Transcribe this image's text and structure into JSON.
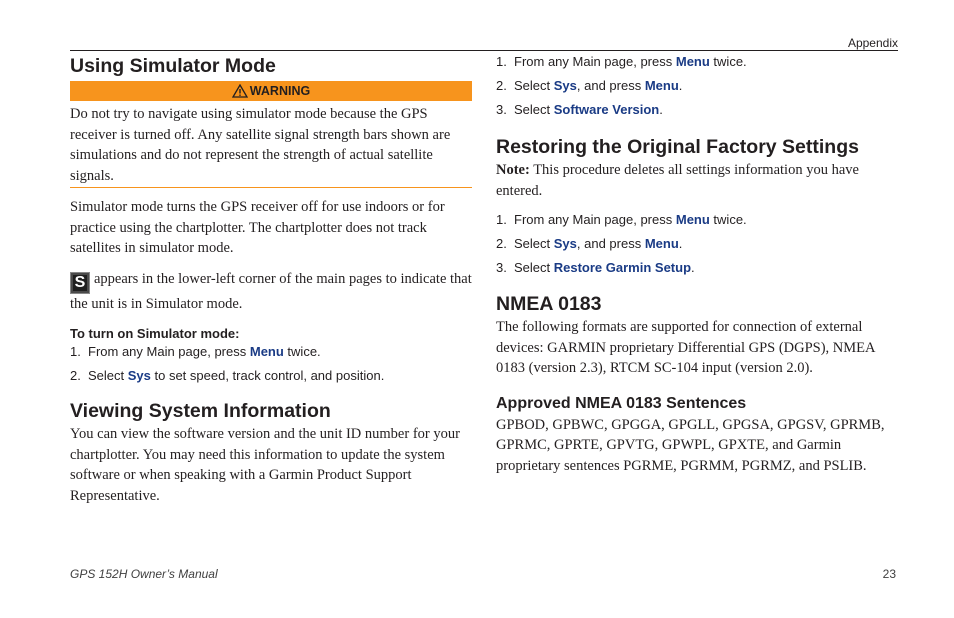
{
  "header": {
    "section": "Appendix"
  },
  "left": {
    "sim_heading": "Using Simulator Mode",
    "warning_label": "WARNING",
    "warning_text": "Do not try to navigate using simulator mode because the GPS receiver is turned off. Any satellite signal strength bars shown are simulations and do not represent the strength of actual satellite signals.",
    "sim_para1": "Simulator mode turns the GPS receiver off for use indoors or for practice using the chartplotter. The chartplotter does not track satellites in simulator mode.",
    "sim_icon_letter": "S",
    "sim_para2": "appears in the lower-left corner of the main pages to indicate that the unit is in Simulator mode.",
    "proc_heading": "To turn on Simulator mode:",
    "steps": [
      {
        "num": "1.",
        "pre": "From any Main page, press ",
        "kw": "Menu",
        "post": " twice."
      },
      {
        "num": "2.",
        "pre": "Select ",
        "kw": "Sys",
        "post": " to set speed, track control, and position."
      }
    ],
    "sysinfo_heading": "Viewing System Information",
    "sysinfo_text": "You can view the software version and the unit ID number for your chartplotter. You may need this information to update the system software or when speaking with a Garmin Product Support Representative."
  },
  "right": {
    "steps_top": [
      {
        "num": "1.",
        "pre": "From any Main page, press ",
        "kw": "Menu",
        "post": " twice."
      },
      {
        "num": "2.",
        "pre": "Select ",
        "kw": "Sys",
        "mid": ", and press ",
        "kw2": "Menu",
        "post": "."
      },
      {
        "num": "3.",
        "pre": "Select ",
        "kw": "Software Version",
        "post": "."
      }
    ],
    "restore_heading": "Restoring the Original Factory Settings",
    "note_label": "Note:",
    "note_text": " This procedure deletes all settings information you have entered.",
    "steps_restore": [
      {
        "num": "1.",
        "pre": "From any Main page, press ",
        "kw": "Menu",
        "post": " twice."
      },
      {
        "num": "2.",
        "pre": "Select ",
        "kw": "Sys",
        "mid": ", and press ",
        "kw2": "Menu",
        "post": "."
      },
      {
        "num": "3.",
        "pre": "Select ",
        "kw": "Restore Garmin Setup",
        "post": "."
      }
    ],
    "nmea_heading": "NMEA 0183",
    "nmea_text": "The following formats are supported for connection of external devices: GARMIN proprietary Differential GPS (DGPS), NMEA 0183 (version 2.3), RTCM SC-104 input (version 2.0).",
    "approved_heading": "Approved NMEA 0183 Sentences",
    "approved_text": "GPBOD, GPBWC, GPGGA, GPGLL, GPGSA, GPGSV, GPRMB, GPRMC, GPRTE, GPVTG, GPWPL, GPXTE, and Garmin proprietary sentences PGRME, PGRMM, PGRMZ, and PSLIB."
  },
  "footer": {
    "manual": "GPS 152H Owner’s Manual",
    "page": "23"
  },
  "colors": {
    "warning_bar": "#f7941d",
    "keyword": "#1a3b85"
  }
}
